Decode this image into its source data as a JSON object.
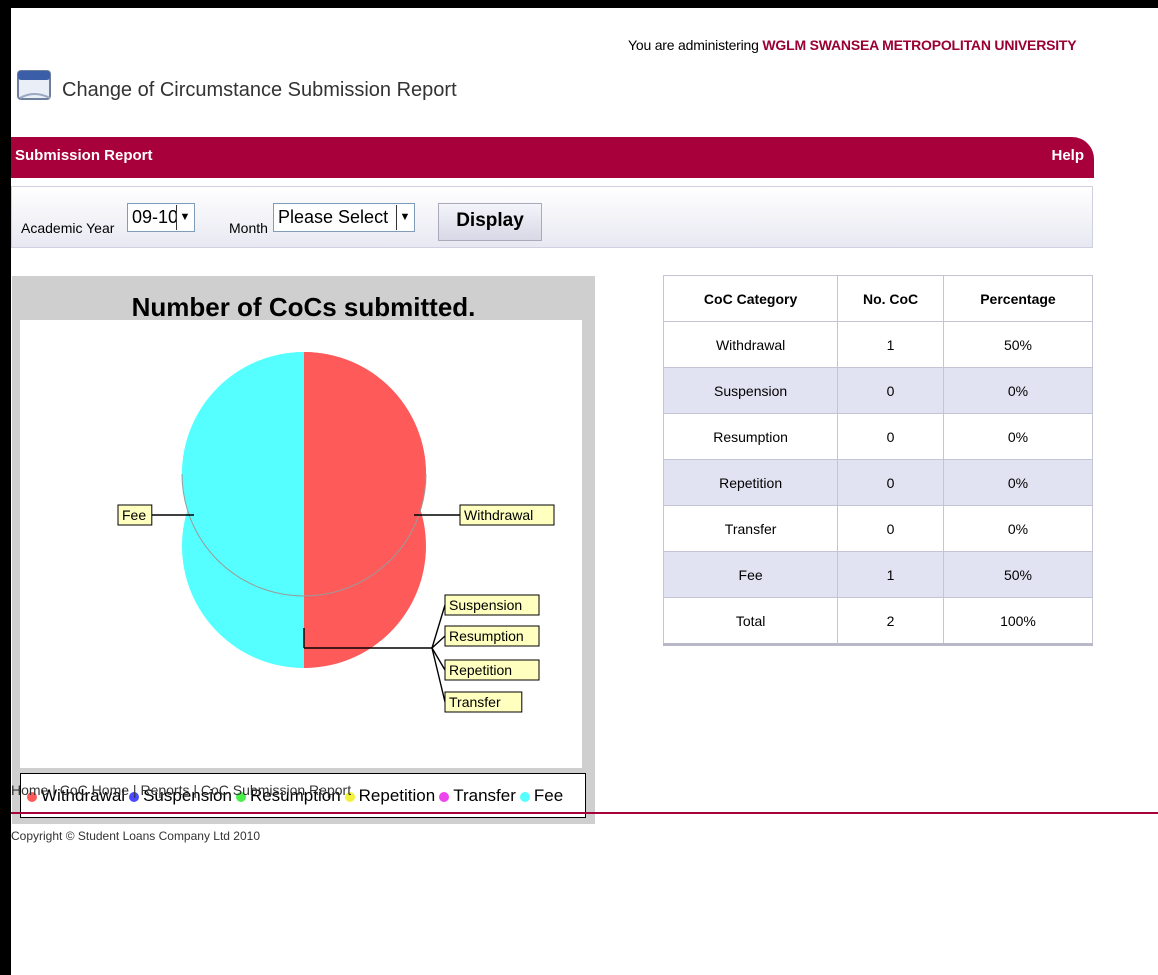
{
  "header": {
    "admin_prefix": "You are administering",
    "admin_org": "WGLM SWANSEA METROPOLITAN UNIVERSITY",
    "page_title": "Change of Circumstance Submission Report"
  },
  "bar": {
    "title": "Submission Report",
    "help": "Help"
  },
  "filters": {
    "academic_year_label": "Academic Year",
    "academic_year_value": "09-10",
    "month_label": "Month",
    "month_value": "Please Select",
    "display_button": "Display"
  },
  "chart_data": {
    "type": "pie",
    "title": "Number of CoCs submitted.",
    "categories": [
      "Withdrawal",
      "Suspension",
      "Resumption",
      "Repetition",
      "Transfer",
      "Fee"
    ],
    "values": [
      1,
      0,
      0,
      0,
      0,
      1
    ],
    "colors": [
      "#ff5a5a",
      "#4a4aff",
      "#4cee4c",
      "#f2f23c",
      "#ee44ee",
      "#55ffff"
    ],
    "legend_position": "bottom"
  },
  "table": {
    "headers": [
      "CoC Category",
      "No. CoC",
      "Percentage"
    ],
    "rows": [
      [
        "Withdrawal",
        "1",
        "50%"
      ],
      [
        "Suspension",
        "0",
        "0%"
      ],
      [
        "Resumption",
        "0",
        "0%"
      ],
      [
        "Repetition",
        "0",
        "0%"
      ],
      [
        "Transfer",
        "0",
        "0%"
      ],
      [
        "Fee",
        "1",
        "50%"
      ],
      [
        "Total",
        "2",
        "100%"
      ]
    ]
  },
  "breadcrumb": {
    "items": [
      "Home",
      "CoC Home",
      "Reports",
      "CoC Submission Report"
    ],
    "separator": "|"
  },
  "footer": {
    "copyright": "Copyright © Student Loans Company Ltd 2010"
  },
  "icons": {
    "page_icon": "document-icon"
  }
}
